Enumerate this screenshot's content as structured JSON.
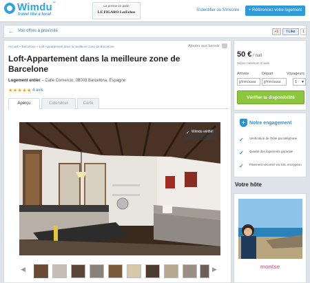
{
  "header": {
    "logo": "Wimdu",
    "logo_tm": "™",
    "tagline": "travel like a local",
    "press_label": "La presse en parle",
    "press_logos": "LE FIGARO  LesEchos",
    "login": "S'identifier ou S'inscrire",
    "list_button": "+ Référencez votre logement"
  },
  "backbar": {
    "arrow": "←",
    "back_link": "Voir offres à proximité",
    "gplus": "+1",
    "like": "f Like",
    "like_count": "1"
  },
  "listing": {
    "breadcrumb": "Accueil » Barcelone » Loft-Appartement dans la meilleure zone de Barcelone",
    "favorites": "Ajouter aux favoris",
    "title": "Loft-Appartement dans la meilleure zone de Barcelone",
    "type": "Logement entier",
    "address": " – Calle Comercio, 08003 Barcelona, Espagne",
    "stars": "★★★★★",
    "reviews": "4 avis",
    "tabs": [
      "Aperçu",
      "Calendrier",
      "Carte"
    ],
    "badge": "Wimdu vérifié!",
    "badge_check": "✓"
  },
  "gallery": {
    "prev": "◀",
    "next": "▶",
    "thumb_colors": [
      "#6b4a34",
      "#c7bfb5",
      "#5a4636",
      "#8a8178",
      "#7a5b3a",
      "#d8c7a8",
      "#4c3b2e",
      "#b8a890",
      "#9a8f85",
      "#6d5f56"
    ]
  },
  "booking": {
    "price": "50 €",
    "price_unit": " / nuit",
    "min_stay": "Séjour minimum 2 nuits",
    "arrival_label": "Arrivée",
    "departure_label": "Départ",
    "guests_label": "Voyageurs",
    "arrival_placeholder": "jj/mm/aaaa",
    "departure_placeholder": "jj/mm/aaaa",
    "guests_value": "1",
    "check_button": "Vérifier la disponibilité"
  },
  "commitment": {
    "title": "Notre engagement",
    "check": "✓",
    "items": [
      "Vérification de l'hôte par téléphone",
      "Qualité des logements garantie!",
      "Paiement sécurisé via SSL encryption"
    ]
  },
  "host": {
    "title": "Votre hôte",
    "name": "montse"
  },
  "colors": {
    "brand": "#2fa3e0",
    "cta_green": "#8bc63e",
    "link": "#2a7ab8",
    "host_pink": "#e0709a"
  }
}
